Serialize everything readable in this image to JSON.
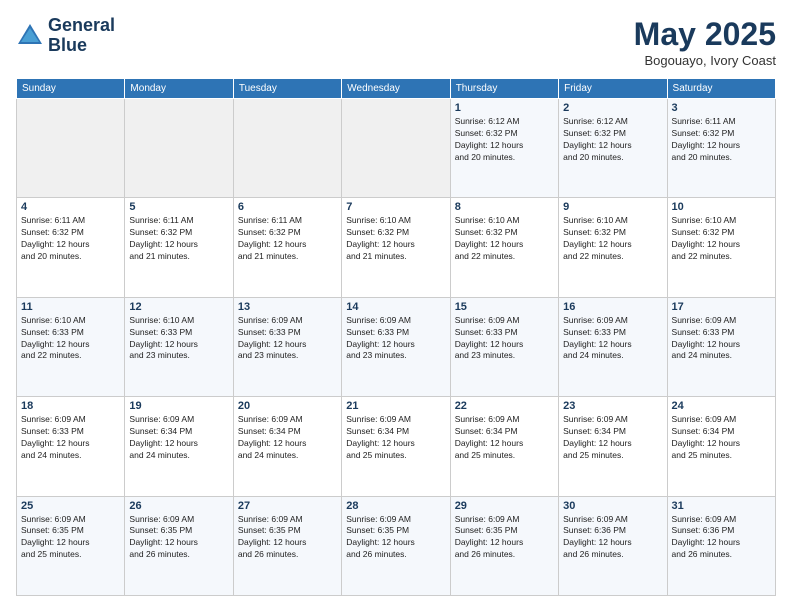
{
  "logo": {
    "line1": "General",
    "line2": "Blue"
  },
  "title": "May 2025",
  "location": "Bogouayo, Ivory Coast",
  "days_of_week": [
    "Sunday",
    "Monday",
    "Tuesday",
    "Wednesday",
    "Thursday",
    "Friday",
    "Saturday"
  ],
  "weeks": [
    [
      {
        "day": "",
        "info": ""
      },
      {
        "day": "",
        "info": ""
      },
      {
        "day": "",
        "info": ""
      },
      {
        "day": "",
        "info": ""
      },
      {
        "day": "1",
        "info": "Sunrise: 6:12 AM\nSunset: 6:32 PM\nDaylight: 12 hours\nand 20 minutes."
      },
      {
        "day": "2",
        "info": "Sunrise: 6:12 AM\nSunset: 6:32 PM\nDaylight: 12 hours\nand 20 minutes."
      },
      {
        "day": "3",
        "info": "Sunrise: 6:11 AM\nSunset: 6:32 PM\nDaylight: 12 hours\nand 20 minutes."
      }
    ],
    [
      {
        "day": "4",
        "info": "Sunrise: 6:11 AM\nSunset: 6:32 PM\nDaylight: 12 hours\nand 20 minutes."
      },
      {
        "day": "5",
        "info": "Sunrise: 6:11 AM\nSunset: 6:32 PM\nDaylight: 12 hours\nand 21 minutes."
      },
      {
        "day": "6",
        "info": "Sunrise: 6:11 AM\nSunset: 6:32 PM\nDaylight: 12 hours\nand 21 minutes."
      },
      {
        "day": "7",
        "info": "Sunrise: 6:10 AM\nSunset: 6:32 PM\nDaylight: 12 hours\nand 21 minutes."
      },
      {
        "day": "8",
        "info": "Sunrise: 6:10 AM\nSunset: 6:32 PM\nDaylight: 12 hours\nand 22 minutes."
      },
      {
        "day": "9",
        "info": "Sunrise: 6:10 AM\nSunset: 6:32 PM\nDaylight: 12 hours\nand 22 minutes."
      },
      {
        "day": "10",
        "info": "Sunrise: 6:10 AM\nSunset: 6:32 PM\nDaylight: 12 hours\nand 22 minutes."
      }
    ],
    [
      {
        "day": "11",
        "info": "Sunrise: 6:10 AM\nSunset: 6:33 PM\nDaylight: 12 hours\nand 22 minutes."
      },
      {
        "day": "12",
        "info": "Sunrise: 6:10 AM\nSunset: 6:33 PM\nDaylight: 12 hours\nand 23 minutes."
      },
      {
        "day": "13",
        "info": "Sunrise: 6:09 AM\nSunset: 6:33 PM\nDaylight: 12 hours\nand 23 minutes."
      },
      {
        "day": "14",
        "info": "Sunrise: 6:09 AM\nSunset: 6:33 PM\nDaylight: 12 hours\nand 23 minutes."
      },
      {
        "day": "15",
        "info": "Sunrise: 6:09 AM\nSunset: 6:33 PM\nDaylight: 12 hours\nand 23 minutes."
      },
      {
        "day": "16",
        "info": "Sunrise: 6:09 AM\nSunset: 6:33 PM\nDaylight: 12 hours\nand 24 minutes."
      },
      {
        "day": "17",
        "info": "Sunrise: 6:09 AM\nSunset: 6:33 PM\nDaylight: 12 hours\nand 24 minutes."
      }
    ],
    [
      {
        "day": "18",
        "info": "Sunrise: 6:09 AM\nSunset: 6:33 PM\nDaylight: 12 hours\nand 24 minutes."
      },
      {
        "day": "19",
        "info": "Sunrise: 6:09 AM\nSunset: 6:34 PM\nDaylight: 12 hours\nand 24 minutes."
      },
      {
        "day": "20",
        "info": "Sunrise: 6:09 AM\nSunset: 6:34 PM\nDaylight: 12 hours\nand 24 minutes."
      },
      {
        "day": "21",
        "info": "Sunrise: 6:09 AM\nSunset: 6:34 PM\nDaylight: 12 hours\nand 25 minutes."
      },
      {
        "day": "22",
        "info": "Sunrise: 6:09 AM\nSunset: 6:34 PM\nDaylight: 12 hours\nand 25 minutes."
      },
      {
        "day": "23",
        "info": "Sunrise: 6:09 AM\nSunset: 6:34 PM\nDaylight: 12 hours\nand 25 minutes."
      },
      {
        "day": "24",
        "info": "Sunrise: 6:09 AM\nSunset: 6:34 PM\nDaylight: 12 hours\nand 25 minutes."
      }
    ],
    [
      {
        "day": "25",
        "info": "Sunrise: 6:09 AM\nSunset: 6:35 PM\nDaylight: 12 hours\nand 25 minutes."
      },
      {
        "day": "26",
        "info": "Sunrise: 6:09 AM\nSunset: 6:35 PM\nDaylight: 12 hours\nand 26 minutes."
      },
      {
        "day": "27",
        "info": "Sunrise: 6:09 AM\nSunset: 6:35 PM\nDaylight: 12 hours\nand 26 minutes."
      },
      {
        "day": "28",
        "info": "Sunrise: 6:09 AM\nSunset: 6:35 PM\nDaylight: 12 hours\nand 26 minutes."
      },
      {
        "day": "29",
        "info": "Sunrise: 6:09 AM\nSunset: 6:35 PM\nDaylight: 12 hours\nand 26 minutes."
      },
      {
        "day": "30",
        "info": "Sunrise: 6:09 AM\nSunset: 6:36 PM\nDaylight: 12 hours\nand 26 minutes."
      },
      {
        "day": "31",
        "info": "Sunrise: 6:09 AM\nSunset: 6:36 PM\nDaylight: 12 hours\nand 26 minutes."
      }
    ]
  ]
}
